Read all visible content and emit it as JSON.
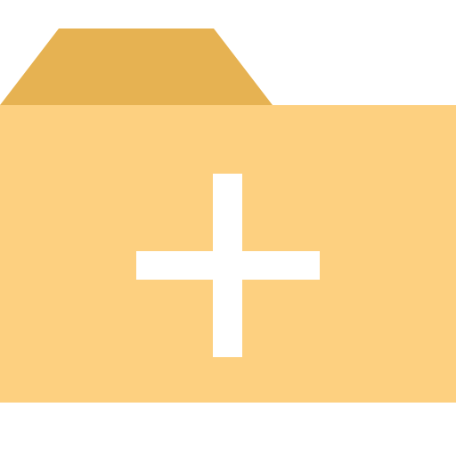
{
  "icon": {
    "name": "add-folder-icon",
    "colors": {
      "folder_tab": "#E6B252",
      "folder_body": "#FDD080",
      "plus_sign": "#FFFFFF",
      "background": "#FFFFFF"
    }
  }
}
